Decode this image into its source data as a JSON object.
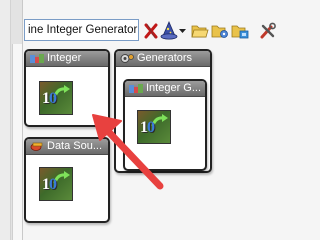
{
  "search": {
    "value": "ine Integer Generator"
  },
  "toolbar": {
    "icons": [
      "remove-x-icon",
      "wizard-hat-icon",
      "dropdown-arrow-icon",
      "folder-open-icon",
      "folder-settings-icon",
      "folder-stack-icon",
      "tools-icon"
    ]
  },
  "blocks": {
    "integer": {
      "title": "Integer"
    },
    "generators": {
      "title": "Generators"
    },
    "integer_generator": {
      "title": "Integer G..."
    },
    "data_source": {
      "title": "Data Sou..."
    }
  },
  "tile_glyph": {
    "one": "1",
    "zero": "0"
  },
  "annotation": {
    "color": "#e8413f"
  }
}
